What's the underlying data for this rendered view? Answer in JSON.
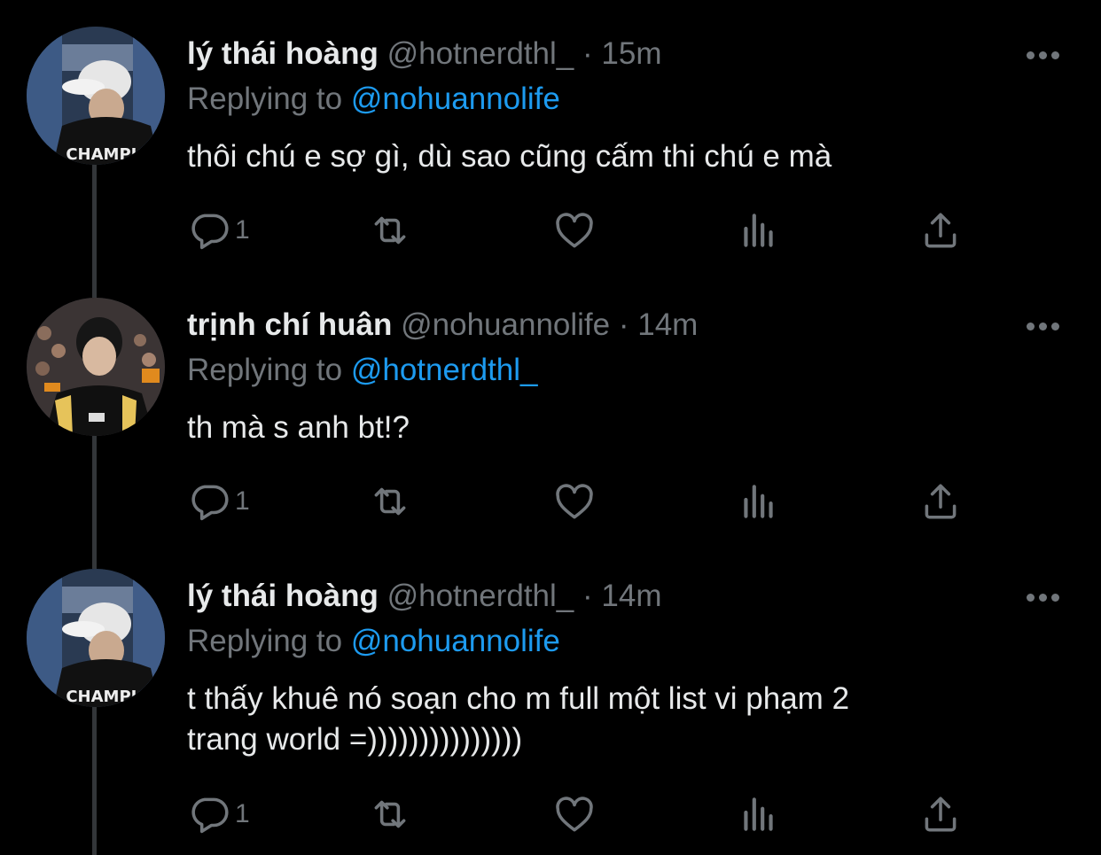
{
  "tweets": [
    {
      "name": "lý thái hoàng",
      "handle": "@hotnerdthl_",
      "separator": "·",
      "time": "15m",
      "replying_prefix": "Replying to",
      "replying_to": "@nohuannolife",
      "text_lines": [
        "thôi chú e sợ gì, dù sao cũng cấm thi chú e mà"
      ],
      "reply_count": "1",
      "avatar": "white-cap-champion-jacket",
      "avatar_caption": "CHAMPIO"
    },
    {
      "name": "trịnh chí huân",
      "handle": "@nohuannolife",
      "separator": "·",
      "time": "14m",
      "replying_prefix": "Replying to",
      "replying_to": "@hotnerdthl_",
      "text_lines": [
        "th mà s anh bt!?"
      ],
      "reply_count": "1",
      "avatar": "esports-jersey-crowd"
    },
    {
      "name": "lý thái hoàng",
      "handle": "@hotnerdthl_",
      "separator": "·",
      "time": "14m",
      "replying_prefix": "Replying to",
      "replying_to": "@nohuannolife",
      "text_lines": [
        "t thấy khuê nó soạn cho m full một list vi phạm 2",
        "trang world =)))))))))))))))"
      ],
      "reply_count": "1",
      "avatar": "white-cap-champion-jacket",
      "avatar_caption": "CHAMPIO"
    }
  ],
  "icons": {
    "reply": "reply-icon",
    "retweet": "retweet-icon",
    "like": "heart-icon",
    "views": "analytics-icon",
    "share": "share-icon",
    "more": "more-dots-icon"
  },
  "colors": {
    "background": "#000000",
    "primary_text": "#e7e9ea",
    "secondary_text": "#71767b",
    "link": "#1d9bf0",
    "thread_line": "#333639"
  }
}
